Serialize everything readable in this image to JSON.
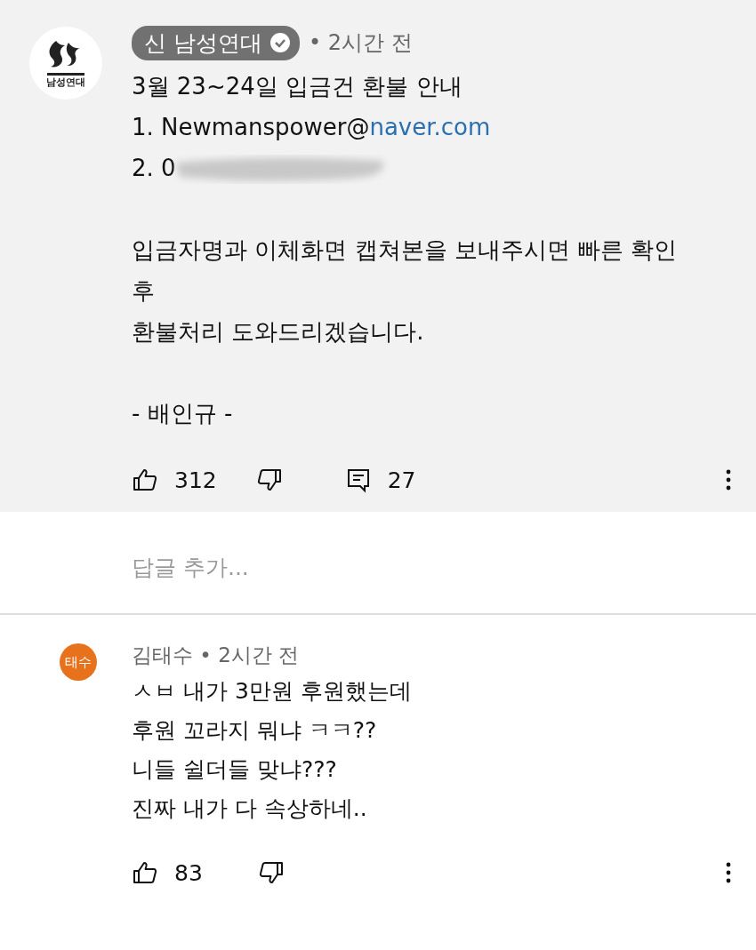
{
  "pinned_comment": {
    "logo_text": "남성연대",
    "author": "신 남성연대",
    "verified": true,
    "time": "• 2시간 전",
    "paragraphs": [
      {
        "lines": [
          {
            "kind": "text",
            "text": "3월 23~24일 입금건 환불 안내"
          },
          {
            "kind": "link",
            "text": "1. Newmanspower@",
            "link": "naver.com"
          },
          {
            "kind": "redacted",
            "text": "2. 0"
          }
        ]
      },
      {
        "lines": [
          {
            "kind": "text",
            "text": "입금자명과 이체화면 캡쳐본을 보내주시면 빠른 확인"
          },
          {
            "kind": "text",
            "text": "후"
          },
          {
            "kind": "text",
            "text": "환불처리 도와드리겠습니다."
          }
        ]
      },
      {
        "lines": [
          {
            "kind": "text",
            "text": "- 배인규 -"
          }
        ]
      }
    ],
    "likes": "312",
    "replies": "27"
  },
  "reply_field": {
    "placeholder": "답글 추가..."
  },
  "comment": {
    "author": "김태수",
    "avatar_text": "태수",
    "time": "• 2시간 전",
    "lines": [
      "ㅅㅂ 내가 3만원 후원했는데",
      "후원 꼬라지 뭐냐 ㅋㅋ??",
      "니들 쉴더들 맞냐???",
      "진짜 내가 다 속상하네.."
    ],
    "likes": "83"
  }
}
